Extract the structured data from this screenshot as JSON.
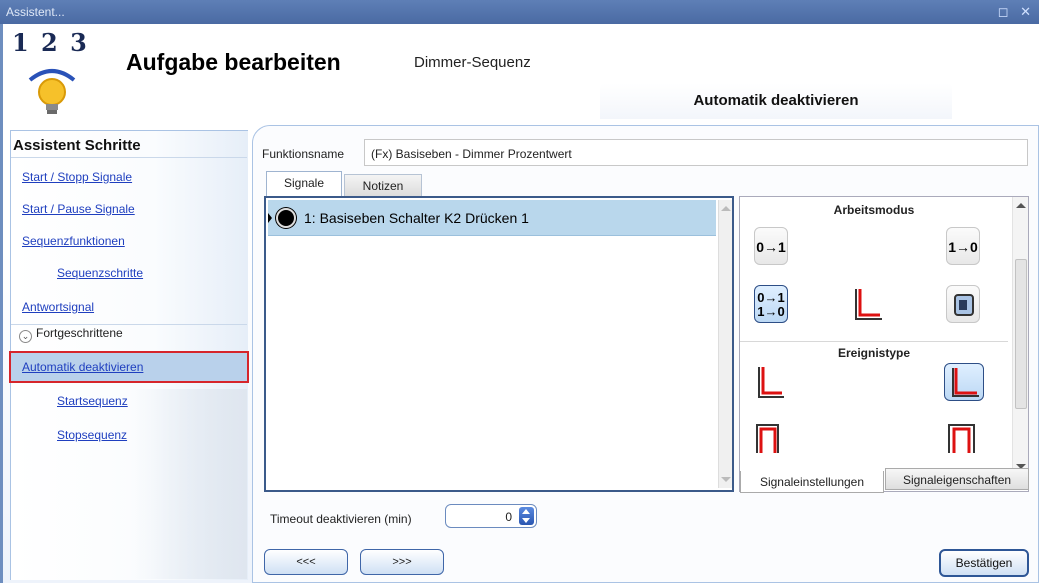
{
  "window": {
    "title": "Assistent...",
    "controls": "◻ ✕"
  },
  "header": {
    "logo_text": "1 2 3",
    "title": "Aufgabe bearbeiten",
    "subtitle": "Dimmer-Sequenz",
    "section_tab": "Automatik deaktivieren"
  },
  "sidebar": {
    "title": "Assistent Schritte",
    "items": [
      {
        "label": "Start / Stopp Signale"
      },
      {
        "label": "Start / Pause Signale"
      },
      {
        "label": "Sequenzfunktionen"
      },
      {
        "label": "Sequenzschritte"
      },
      {
        "label": "Antwortsignal"
      }
    ],
    "advanced_label": "Fortgeschrittene",
    "advanced_items": [
      {
        "label": "Automatik deaktivieren"
      },
      {
        "label": "Startsequenz"
      },
      {
        "label": "Stopsequenz"
      }
    ]
  },
  "form": {
    "function_name_label": "Funktionsname",
    "function_name_value": "(Fx) Basiseben - Dimmer Prozentwert",
    "tabs": {
      "signals": "Signale",
      "notes": "Notizen"
    },
    "signal_row": "1: Basiseben Schalter K2 Drücken 1",
    "mode_header": "Arbeitsmodus",
    "event_header": "Ereignistype",
    "mode_icons": {
      "rise": "0→1",
      "fall": "1→0",
      "both_top": "0→1",
      "both_bottom": "1→0"
    },
    "bottom_tabs": {
      "settings": "Signaleinstellungen",
      "properties": "Signaleigenschaften"
    },
    "timeout_label": "Timeout deaktivieren (min)",
    "timeout_value": "0"
  },
  "buttons": {
    "back": "<<<",
    "next": ">>>",
    "confirm": "Bestätigen"
  }
}
